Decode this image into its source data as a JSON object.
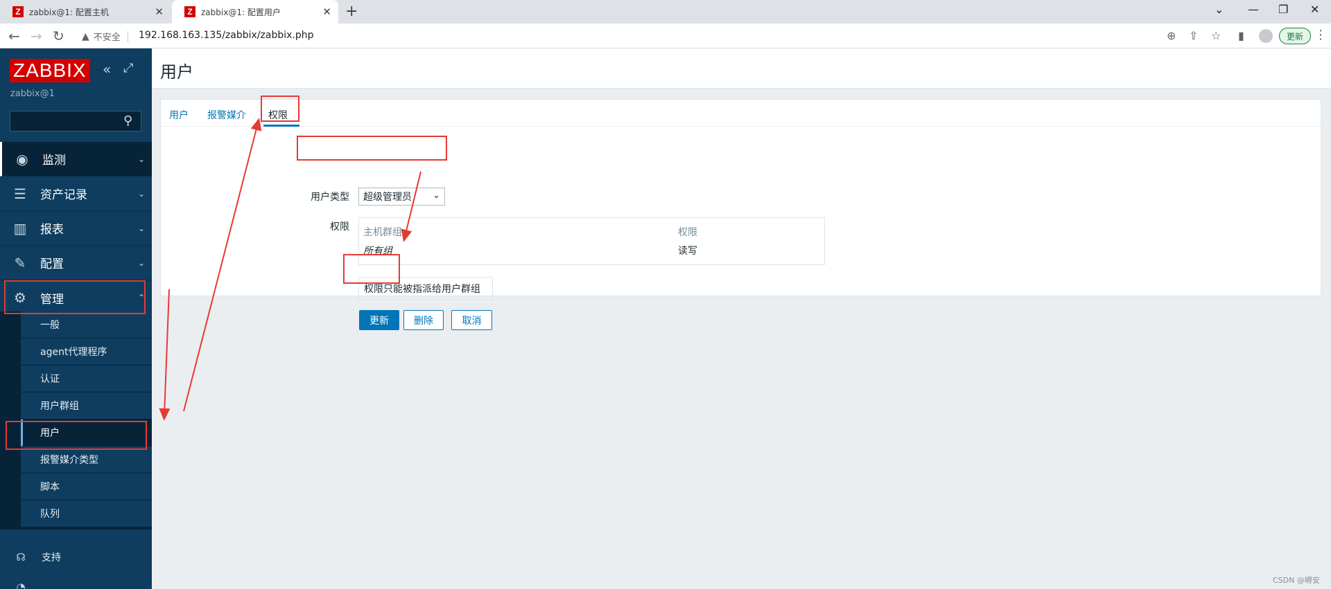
{
  "browser": {
    "tabs": [
      {
        "title": "zabbix@1: 配置主机",
        "favicon": "Z"
      },
      {
        "title": "zabbix@1: 配置用户",
        "favicon": "Z"
      }
    ],
    "security_label": "不安全",
    "url": "192.168.163.135/zabbix/zabbix.php",
    "update_label": "更新"
  },
  "sidebar": {
    "logo": "ZABBIX",
    "server_name": "zabbix@1",
    "menu": [
      {
        "label": "监测",
        "icon": "eye-icon"
      },
      {
        "label": "资产记录",
        "icon": "list-icon"
      },
      {
        "label": "报表",
        "icon": "bar-chart-icon"
      },
      {
        "label": "配置",
        "icon": "wrench-icon"
      },
      {
        "label": "管理",
        "icon": "gear-icon"
      }
    ],
    "submenu": [
      "一般",
      "agent代理程序",
      "认证",
      "用户群组",
      "用户",
      "报警媒介类型",
      "脚本",
      "队列"
    ],
    "support_label": "支持"
  },
  "page": {
    "title": "用户",
    "tabs": [
      "用户",
      "报警媒介",
      "权限"
    ],
    "form": {
      "user_type_label": "用户类型",
      "user_type_value": "超级管理员",
      "permissions_label": "权限",
      "table_headers": [
        "主机群组",
        "权限"
      ],
      "table_row": {
        "group": "所有组",
        "permission": "读写"
      },
      "note": "权限只能被指派给用户群组"
    },
    "buttons": {
      "update": "更新",
      "delete": "删除",
      "cancel": "取消"
    }
  },
  "watermark": "CSDN @嘚安"
}
